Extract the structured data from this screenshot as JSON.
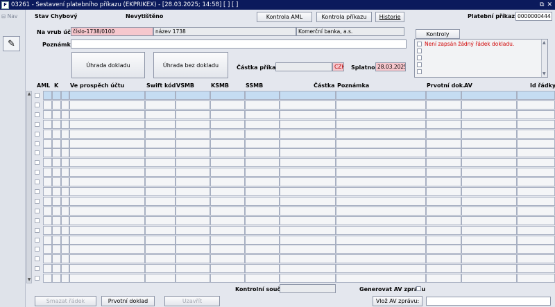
{
  "window": {
    "title": "03261 - Sestavení platebního příkazu (EKPRIKEX) - [28.03.2025; 14:58]  [ ]  [ ]",
    "app_icon_glyph": "F",
    "controls": [
      "⧉",
      "✕"
    ]
  },
  "nav": {
    "label": "⊟ Nav",
    "tool_icon": "✎"
  },
  "header": {
    "stav_label": "Stav",
    "stav_value": "Chybový",
    "print_status": "Nevytištěno",
    "kontrola_aml": "Kontrola AML",
    "kontrola_prikazu": "Kontrola příkazu",
    "historie": "Historie",
    "platebni_prikaz_label": "Platební příkaz č.",
    "platebni_prikaz_value": "0000000444"
  },
  "account": {
    "label": "Na vrub účtu",
    "number": "číslo-1738/0100",
    "name": "název 1738",
    "bank": "Komerční banka, a.s."
  },
  "note": {
    "label": "Poznámka",
    "value": ""
  },
  "actions": {
    "uhrada_dokladu": "Úhrada dokladu",
    "uhrada_bez_dokladu": "Úhrada bez dokladu"
  },
  "amount": {
    "label": "Částka příkazu",
    "value": "",
    "currency": "CZK",
    "splatnost_label": "Splatnost",
    "splatnost_value": "28.03.2025"
  },
  "kontroly": {
    "title": "Kontroly",
    "messages": [
      "Není zapsán žádný řádek dokladu.",
      "",
      "",
      "",
      ""
    ]
  },
  "grid": {
    "columns": [
      "AML",
      "K",
      "Ve prospěch účtu",
      "Swift kód",
      "VSMB",
      "KSMB",
      "SSMB",
      "Částka",
      "Poznámka",
      "Prvotní dok.",
      "AV",
      "Id řádky"
    ],
    "row_count": 20
  },
  "footer": {
    "kontrolni_soucet_label": "Kontrolní součet",
    "kontrolni_soucet_value": "",
    "generovat_av_label": "Generovat AV zprávu",
    "smazat_radek": "Smazat řádek",
    "prvotni_doklad": "Prvotní doklad",
    "uzavrit": "Uzavřít",
    "vloz_av_zpravu": "Vlož AV zprávu:",
    "av_zprava_value": ""
  },
  "colors": {
    "titlebar": "#0b1a5c",
    "background": "#e4e7ee",
    "required_field": "#f6c7cd",
    "error_text": "#d10000",
    "selected_row": "#c5dcf2"
  }
}
